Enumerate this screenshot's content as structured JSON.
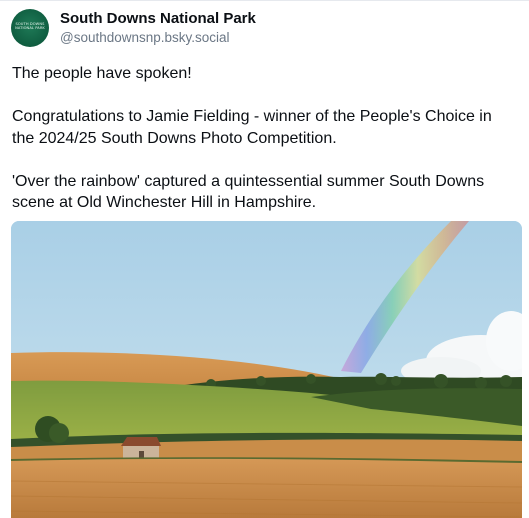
{
  "author": {
    "display_name": "South Downs National Park",
    "handle": "@southdownsnp.bsky.social",
    "avatar_logo_text": "SOUTH DOWNS NATIONAL PARK"
  },
  "post": {
    "paragraphs": [
      "The people have spoken!",
      "Congratulations to Jamie Fielding - winner of the People's Choice in the 2024/25 South Downs Photo Competition.",
      "'Over the rainbow' captured a quintessential summer South Downs scene at Old Winchester Hill in Hampshire."
    ]
  },
  "photo": {
    "subject": "rainbow over rolling farmland with a small stone barn"
  },
  "colors": {
    "avatar_green": "#0f5d40",
    "handle_gray": "#6b7785",
    "text": "#0b0f14"
  }
}
